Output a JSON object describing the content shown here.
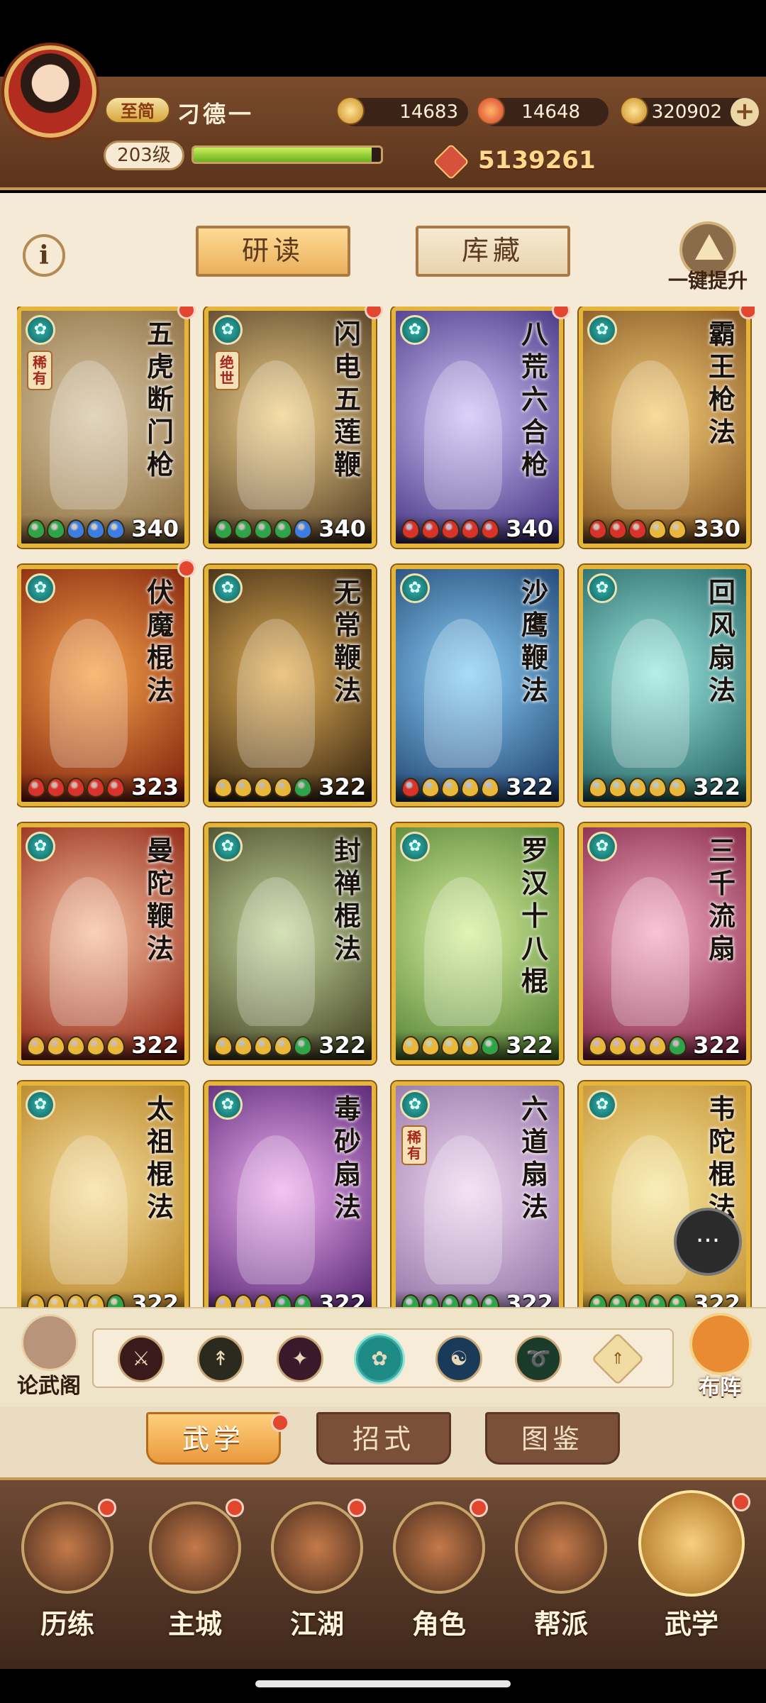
{
  "player": {
    "vip_label": "至简",
    "name": "刁德一",
    "level": "203级",
    "xp_fraction": 0.95,
    "combat_power": "5139261"
  },
  "resources": [
    {
      "icon": "copper-coin-icon",
      "value": "14683"
    },
    {
      "icon": "fire-gem-icon",
      "value": "14648"
    },
    {
      "icon": "gold-ingot-icon",
      "value": "320902"
    }
  ],
  "top_tabs": {
    "study": "研读",
    "storage": "库藏",
    "one_key_upgrade": "一键提升"
  },
  "cards": [
    {
      "title": "五虎断门枪",
      "level": "340",
      "rarity": "稀有",
      "bg": [
        "#d9c8a8",
        "#8a6a3a"
      ],
      "dots": [
        "#2fa34a",
        "#2fa34a",
        "#3b7de0",
        "#3b7de0",
        "#3b7de0"
      ],
      "badge": true
    },
    {
      "title": "闪电五莲鞭",
      "level": "340",
      "rarity": "绝世",
      "bg": [
        "#f2d28a",
        "#4a3520"
      ],
      "dots": [
        "#2fa34a",
        "#2fa34a",
        "#2fa34a",
        "#2fa34a",
        "#3b7de0"
      ],
      "badge": true
    },
    {
      "title": "八荒六合枪",
      "level": "340",
      "rarity": "",
      "bg": [
        "#cfc2f7",
        "#3c2a7a"
      ],
      "dots": [
        "#d8322a",
        "#d8322a",
        "#d8322a",
        "#d8322a",
        "#d8322a"
      ],
      "badge": true
    },
    {
      "title": "霸王枪法",
      "level": "330",
      "rarity": "",
      "bg": [
        "#f7cf7a",
        "#7a4a1a"
      ],
      "dots": [
        "#d8322a",
        "#d8322a",
        "#d8322a",
        "#e9b73a",
        "#e9b73a"
      ],
      "badge": true
    },
    {
      "title": "伏魔棍法",
      "level": "323",
      "rarity": "",
      "bg": [
        "#f7a34a",
        "#7a1a0a"
      ],
      "dots": [
        "#d8322a",
        "#d8322a",
        "#d8322a",
        "#d8322a",
        "#d8322a"
      ],
      "badge": true
    },
    {
      "title": "无常鞭法",
      "level": "322",
      "rarity": "",
      "bg": [
        "#e6b35a",
        "#2a1a0a"
      ],
      "dots": [
        "#e9b73a",
        "#e9b73a",
        "#e9b73a",
        "#e9b73a",
        "#2fa34a"
      ],
      "badge": false
    },
    {
      "title": "沙鹰鞭法",
      "level": "322",
      "rarity": "",
      "bg": [
        "#8ad0f7",
        "#1a3a6a"
      ],
      "dots": [
        "#d8322a",
        "#e9b73a",
        "#e9b73a",
        "#e9b73a",
        "#e9b73a"
      ],
      "badge": false
    },
    {
      "title": "回风扇法",
      "level": "322",
      "rarity": "",
      "bg": [
        "#9ee8e0",
        "#1a5a5a"
      ],
      "dots": [
        "#e9b73a",
        "#e9b73a",
        "#e9b73a",
        "#e9b73a",
        "#e9b73a"
      ],
      "badge": false
    },
    {
      "title": "曼陀鞭法",
      "level": "322",
      "rarity": "",
      "bg": [
        "#f7c2a0",
        "#8a1a0a"
      ],
      "dots": [
        "#e9b73a",
        "#e9b73a",
        "#e9b73a",
        "#e9b73a",
        "#e9b73a"
      ],
      "badge": false
    },
    {
      "title": "封禅棍法",
      "level": "322",
      "rarity": "",
      "bg": [
        "#c8d8a0",
        "#3a3a1a"
      ],
      "dots": [
        "#e9b73a",
        "#e9b73a",
        "#e9b73a",
        "#e9b73a",
        "#2fa34a"
      ],
      "badge": false
    },
    {
      "title": "罗汉十八棍",
      "level": "322",
      "rarity": "",
      "bg": [
        "#d8f0a0",
        "#4a7a2a"
      ],
      "dots": [
        "#e9b73a",
        "#e9b73a",
        "#e9b73a",
        "#e9b73a",
        "#2fa34a"
      ],
      "badge": false
    },
    {
      "title": "三千流扇",
      "level": "322",
      "rarity": "",
      "bg": [
        "#f7b0c8",
        "#7a1a3a"
      ],
      "dots": [
        "#e9b73a",
        "#e9b73a",
        "#e9b73a",
        "#e9b73a",
        "#2fa34a"
      ],
      "badge": false
    },
    {
      "title": "太祖棍法",
      "level": "322",
      "rarity": "",
      "bg": [
        "#f7e0a0",
        "#b07a1a"
      ],
      "dots": [
        "#e9b73a",
        "#e9b73a",
        "#e9b73a",
        "#e9b73a",
        "#2fa34a"
      ],
      "badge": false
    },
    {
      "title": "毒砂扇法",
      "level": "322",
      "rarity": "",
      "bg": [
        "#f0b0f0",
        "#4a1a6a"
      ],
      "dots": [
        "#e9b73a",
        "#e9b73a",
        "#e9b73a",
        "#2fa34a",
        "#2fa34a"
      ],
      "badge": false
    },
    {
      "title": "六道扇法",
      "level": "322",
      "rarity": "稀有",
      "bg": [
        "#f0d8f0",
        "#8a6aa0"
      ],
      "dots": [
        "#2fa34a",
        "#2fa34a",
        "#2fa34a",
        "#2fa34a",
        "#2fa34a"
      ],
      "badge": false
    },
    {
      "title": "韦陀棍法",
      "level": "322",
      "rarity": "",
      "bg": [
        "#f7e8a0",
        "#c08a2a"
      ],
      "dots": [
        "#2fa34a",
        "#2fa34a",
        "#2fa34a",
        "#2fa34a",
        "#2fa34a"
      ],
      "badge": false
    }
  ],
  "filters": {
    "left_label": "论武阁",
    "right_label": "布阵",
    "icons": [
      {
        "name": "sword-filter-icon",
        "glyph": "⚔",
        "color": "#3a1a1a",
        "selected": false
      },
      {
        "name": "spear-filter-icon",
        "glyph": "↟",
        "color": "#2a2a1e",
        "selected": false
      },
      {
        "name": "claw-filter-icon",
        "glyph": "✦",
        "color": "#3a1a2a",
        "selected": false
      },
      {
        "name": "fan-filter-icon",
        "glyph": "✿",
        "color": "#1e8a86",
        "selected": true
      },
      {
        "name": "yinyang-filter-icon",
        "glyph": "☯",
        "color": "#1a3a5a",
        "selected": false
      },
      {
        "name": "whip-filter-icon",
        "glyph": "➰",
        "color": "#1a3a2a",
        "selected": false
      },
      {
        "name": "up-arrow-filter-icon",
        "glyph": "⇑",
        "color": "#f0dca0",
        "selected": false
      }
    ]
  },
  "sub_tabs": {
    "martial": "武学",
    "moves": "招式",
    "codex": "图鉴"
  },
  "nav": [
    {
      "key": "training",
      "label": "历练"
    },
    {
      "key": "city",
      "label": "主城"
    },
    {
      "key": "jianghu",
      "label": "江湖"
    },
    {
      "key": "character",
      "label": "角色"
    },
    {
      "key": "guild",
      "label": "帮派"
    },
    {
      "key": "martial",
      "label": "武学"
    }
  ],
  "colors": {
    "card_border": "#e5b43a",
    "badge_red": "#e2462f",
    "header_brown": "#6a4026"
  }
}
